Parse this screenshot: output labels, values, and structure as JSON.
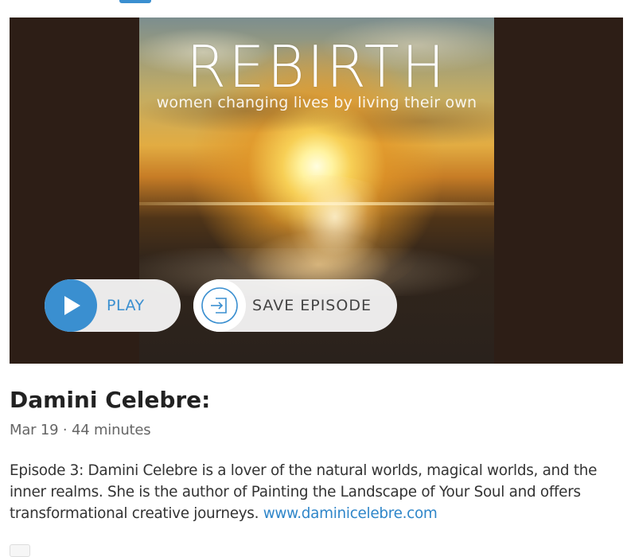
{
  "cover_art": {
    "title": "REBIRTH",
    "subtitle": "women changing lives by living their own"
  },
  "controls": {
    "play_label": "PLAY",
    "save_label": "SAVE EPISODE",
    "play_icon": "play-icon",
    "save_icon": "save-episode-icon"
  },
  "episode": {
    "title": "Damini Celebre:",
    "meta": "Mar 19 · 44 minutes",
    "description": "Episode 3: Damini Celebre is a lover of the natural worlds, magical worlds, and the inner realms. She is the author of Painting the Landscape of Your Soul and offers transformational creative journeys.",
    "link_text": "www.daminicelebre.com"
  },
  "colors": {
    "accent": "#3a8fd0",
    "player_background": "#2d1e16"
  }
}
